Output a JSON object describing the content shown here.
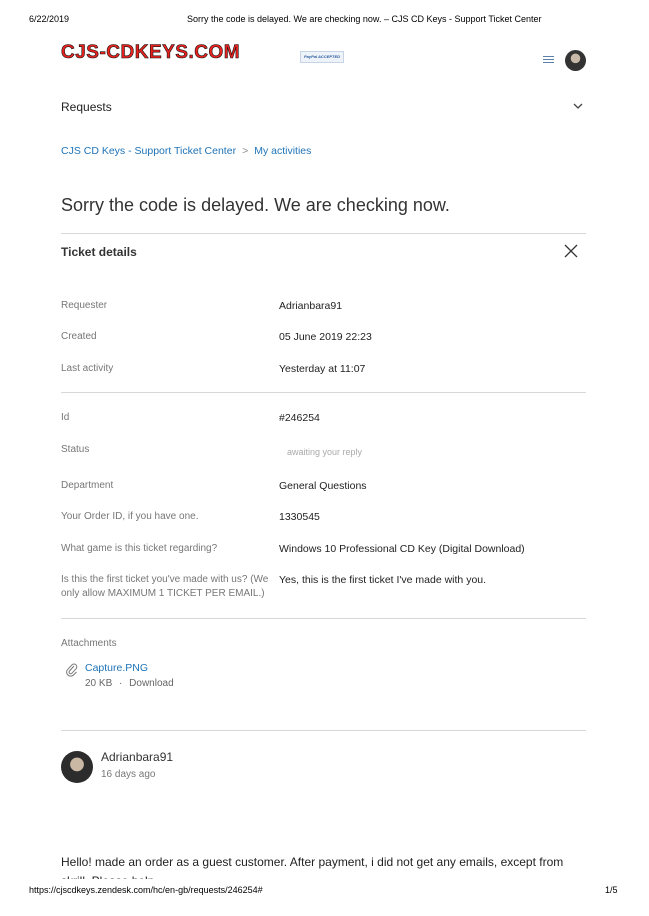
{
  "print_header": {
    "date": "6/22/2019",
    "title": "Sorry the code is delayed. We are checking now. – CJS CD Keys - Support Ticket Center"
  },
  "logo": {
    "text": "CJS-CDKEYS.COM",
    "badge": "PayPal ACCEPTED"
  },
  "nav": {
    "requests_label": "Requests"
  },
  "breadcrumb": {
    "home": "CJS CD Keys - Support Ticket Center",
    "separator": ">",
    "current": "My activities"
  },
  "ticket": {
    "title": "Sorry the code is delayed. We are checking now.",
    "details_heading": "Ticket details",
    "meta": [
      {
        "label": "Requester",
        "value": "Adrianbara91"
      },
      {
        "label": "Created",
        "value": "05 June 2019 22:23"
      },
      {
        "label": "Last activity",
        "value": "Yesterday at 11:07"
      }
    ],
    "fields": [
      {
        "label": "Id",
        "value": "#246254"
      },
      {
        "label": "Status",
        "value": "awaiting your reply"
      },
      {
        "label": "Department",
        "value": "General Questions"
      },
      {
        "label": "Your Order ID, if you have one.",
        "value": "1330545"
      },
      {
        "label": "What game is this ticket regarding?",
        "value": "Windows 10 Professional CD Key (Digital Download)"
      },
      {
        "label": "Is this the first ticket you've made with us? (We only allow MAXIMUM 1 TICKET PER EMAIL.)",
        "value": "Yes, this is the first ticket I've made with you."
      }
    ],
    "attachments_heading": "Attachments",
    "attachment": {
      "name": "Capture.PNG",
      "size": "20 KB",
      "dot": "·",
      "download": "Download"
    }
  },
  "comment": {
    "author": "Adrianbara91",
    "ago": "16 days ago",
    "text": "Hello! made an order as a guest customer. After payment, i did not get any emails, except from skrill. Please help"
  },
  "print_footer": {
    "url": "https://cjscdkeys.zendesk.com/hc/en-gb/requests/246254#",
    "page": "1/5"
  }
}
